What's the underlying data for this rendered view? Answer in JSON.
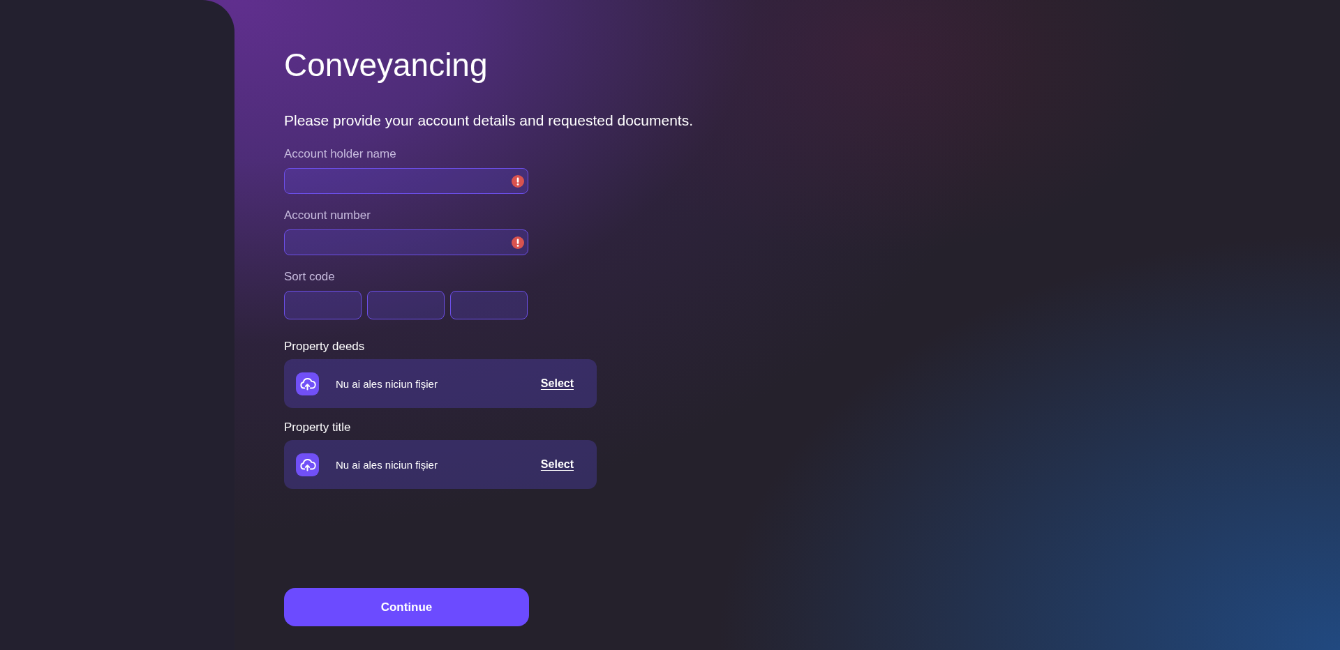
{
  "page": {
    "title": "Conveyancing",
    "subtitle": "Please provide your account details and requested documents."
  },
  "form": {
    "fields": [
      {
        "kind": "text",
        "label": "Account holder name",
        "invalid": true
      },
      {
        "kind": "text",
        "label": "Account number",
        "invalid": true
      },
      {
        "kind": "split",
        "label": "Sort code",
        "boxes": [
          {
            "invalid": false
          },
          {
            "invalid": false
          },
          {
            "invalid": false
          }
        ]
      },
      {
        "kind": "file",
        "label": "Property deeds",
        "status": "Nu ai ales niciun fișier",
        "action": "Select"
      },
      {
        "kind": "file",
        "label": "Property title",
        "status": "Nu ai ales niciun fișier",
        "action": "Select"
      }
    ]
  },
  "continue_button": {
    "label": "Continue"
  }
}
